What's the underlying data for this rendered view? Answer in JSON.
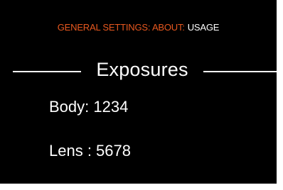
{
  "header": {
    "breadcrumb_path": "GENERAL SETTINGS: ABOUT:",
    "breadcrumb_current": "USAGE"
  },
  "section": {
    "title": "Exposures"
  },
  "stats": {
    "body_label": "Body: 1234",
    "lens_label": "Lens : 5678"
  },
  "colors": {
    "background": "#000000",
    "accent": "#e8581f",
    "text": "#ffffff"
  }
}
